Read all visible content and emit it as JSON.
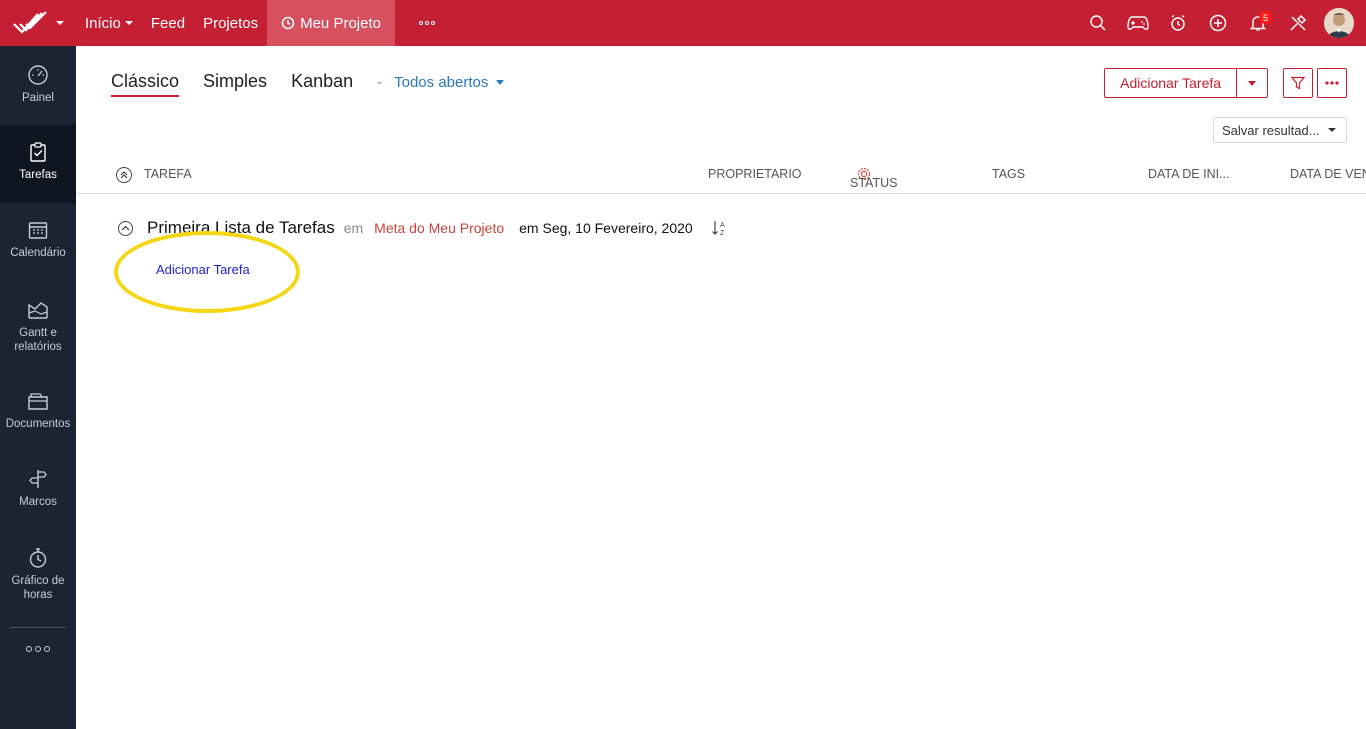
{
  "topbar": {
    "nav": [
      {
        "label": "Início"
      },
      {
        "label": "Feed"
      },
      {
        "label": "Projetos"
      },
      {
        "label": "Meu Projeto"
      }
    ],
    "notification_count": "5",
    "colors": {
      "bar": "#c41f33",
      "active_tab": "#d6505f"
    }
  },
  "sidebar": {
    "items": [
      {
        "label": "Painel",
        "icon": "gauge-icon"
      },
      {
        "label": "Tarefas",
        "icon": "clipboard-check-icon"
      },
      {
        "label": "Calendário",
        "icon": "calendar-icon"
      },
      {
        "label": "Gantt e relatórios",
        "icon": "chart-icon"
      },
      {
        "label": "Documentos",
        "icon": "folder-icon"
      },
      {
        "label": "Marcos",
        "icon": "signpost-icon"
      },
      {
        "label": "Gráfico de horas",
        "icon": "stopwatch-icon"
      }
    ]
  },
  "views": {
    "tabs": [
      {
        "label": "Clássico"
      },
      {
        "label": "Simples"
      },
      {
        "label": "Kanban"
      }
    ],
    "dash": "-",
    "filter": "Todos abertos"
  },
  "actions": {
    "add_task": "Adicionar Tarefa",
    "save_results": "Salvar resultad..."
  },
  "columns": {
    "task": "TAREFA",
    "owner": "PROPRIETARIO",
    "status": "STATUS",
    "tags": "TAGS",
    "start_date": "DATA DE INI...",
    "due_date": "DATA DE VEN"
  },
  "tasklist": {
    "title": "Primeira Lista de Tarefas",
    "em": "em",
    "milestone": "Meta do Meu Projeto",
    "date": "em Seg, 10 Fevereiro, 2020",
    "add_task_link": "Adicionar Tarefa"
  },
  "highlight_color": "#f3d614"
}
